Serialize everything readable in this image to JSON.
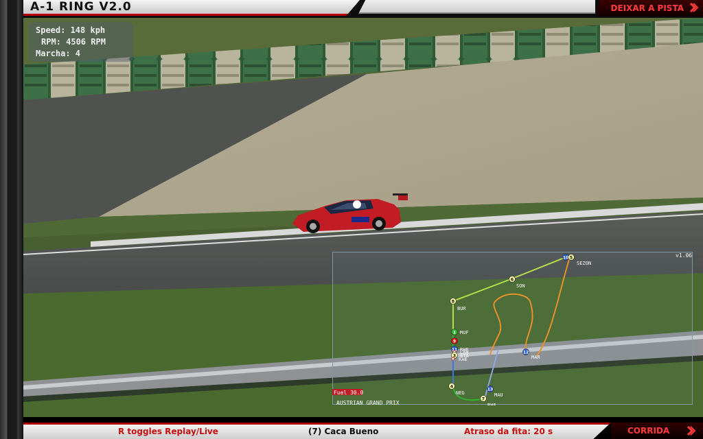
{
  "window": {
    "title": "A-1 RING V2.0"
  },
  "header": {
    "exit_label": "DEIXAR A PISTA"
  },
  "hud": {
    "speed": "Speed: 148 kph",
    "rpm": "RPM: 4506 RPM",
    "gear": "Marcha: 4"
  },
  "track_map": {
    "version": "v1.06",
    "fuel": "Fuel 30.0",
    "event": "AUSTRIAN GRAND PRIX",
    "drivers": [
      {
        "num": "1",
        "code": "MUF",
        "color": "#2db52d"
      },
      {
        "num": "9",
        "code": "",
        "color": "#d11"
      },
      {
        "num": "11",
        "code": "RHE",
        "color": "#2a5bd7"
      },
      {
        "num": "",
        "code": "LAN",
        "color": "#ffffff"
      },
      {
        "num": "3",
        "code": "STA",
        "color": "#f2f2a0"
      },
      {
        "num": "",
        "code": "KAE",
        "color": "#ffffff"
      },
      {
        "num": "8",
        "code": "BUR",
        "color": "#f2f2a0"
      },
      {
        "num": "6",
        "code": "SON",
        "color": "#f2f2a0"
      },
      {
        "num": "10",
        "code": "",
        "color": "#2a5bd7"
      },
      {
        "num": "5",
        "code": "SEZON",
        "color": "#f2f2a0"
      },
      {
        "num": "12",
        "code": "MAR",
        "color": "#2a5bd7"
      },
      {
        "num": "4",
        "code": "NEG",
        "color": "#f2f2a0"
      },
      {
        "num": "13",
        "code": "MAU",
        "color": "#2a5bd7"
      },
      {
        "num": "7",
        "code": "RHE",
        "color": "#f2f2a0"
      }
    ]
  },
  "footer": {
    "hint": "R toggles Replay/Live",
    "driver": "(7) Caca Bueno",
    "delay": "Atraso da fita:  20 s",
    "race_label": "CORRIDA"
  }
}
